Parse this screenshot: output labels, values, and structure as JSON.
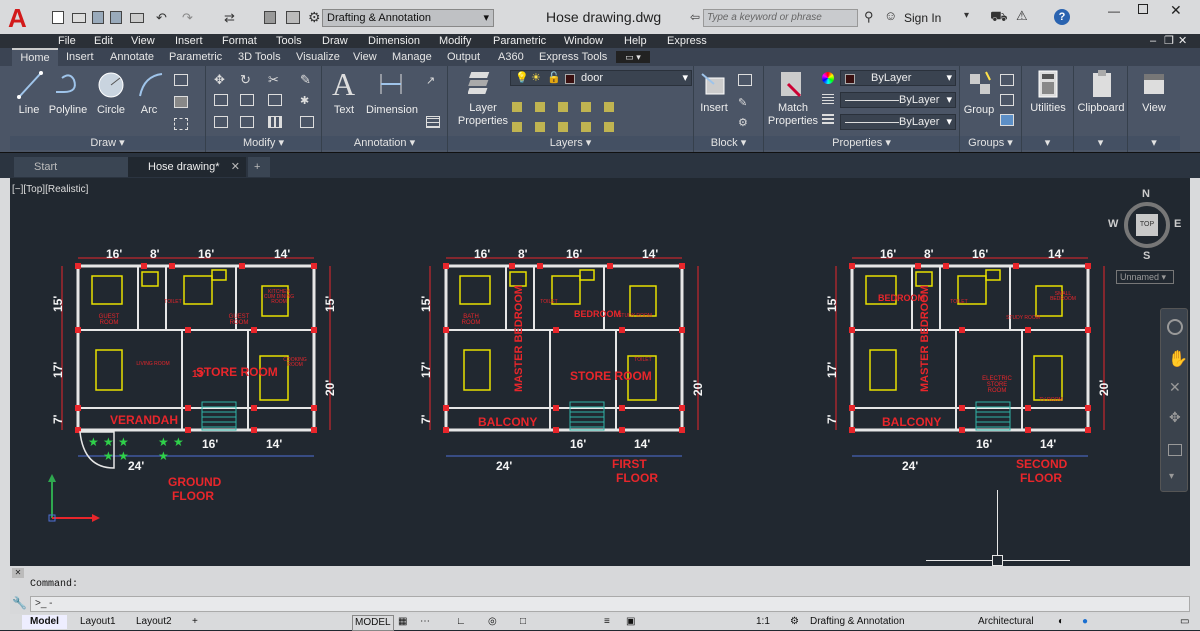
{
  "app": {
    "logo_letter": "A",
    "workspace": "Drafting & Annotation",
    "file_title": "Hose drawing.dwg",
    "search_placeholder": "Type a keyword or phrase",
    "sign_in": "Sign In",
    "help": "?"
  },
  "menu": [
    "File",
    "Edit",
    "View",
    "Insert",
    "Format",
    "Tools",
    "Draw",
    "Dimension",
    "Modify",
    "Parametric",
    "Window",
    "Help",
    "Express"
  ],
  "ribbon_tabs": [
    "Home",
    "Insert",
    "Annotate",
    "Parametric",
    "3D Tools",
    "Visualize",
    "View",
    "Manage",
    "Output",
    "A360",
    "Express Tools"
  ],
  "ribbon": {
    "draw": {
      "label": "Draw",
      "line": "Line",
      "polyline": "Polyline",
      "circle": "Circle",
      "arc": "Arc"
    },
    "modify": {
      "label": "Modify"
    },
    "annotation": {
      "label": "Annotation",
      "text": "Text",
      "dimension": "Dimension"
    },
    "layers": {
      "label": "Layers",
      "layer_properties_1": "Layer",
      "layer_properties_2": "Properties",
      "current_layer": "door"
    },
    "block": {
      "label": "Block",
      "insert": "Insert"
    },
    "properties": {
      "label": "Properties",
      "match_1": "Match",
      "match_2": "Properties",
      "color": "ByLayer",
      "linetype": "ByLayer",
      "lineweight": "ByLayer"
    },
    "groups": {
      "label": "Groups",
      "group": "Group"
    },
    "utilities": "Utilities",
    "clipboard": "Clipboard",
    "view": "View"
  },
  "doc_tabs": {
    "start": "Start",
    "active": "Hose drawing*",
    "add": "+"
  },
  "viewport": {
    "label": "[−][Top][Realistic]",
    "viewcube": {
      "n": "N",
      "s": "S",
      "e": "E",
      "w": "W",
      "top": "TOP"
    },
    "ucs_name": "Unnamed"
  },
  "drawing": {
    "ground": {
      "dims_top": [
        "16'",
        "8'",
        "16'",
        "14'"
      ],
      "dims_left": [
        "15'",
        "17'",
        "7'"
      ],
      "dims_right": [
        "15'",
        "20'"
      ],
      "dims_bottom": [
        "24'",
        "16'",
        "14'"
      ],
      "rooms": [
        "GUEST ROOM",
        "TOILET",
        "GUEST ROOM",
        "KITCHEN CUM DINING ROOM",
        "LIVING ROOM",
        "STORE ROOM",
        "COOKING ROOM",
        "VERANDAH",
        "13'"
      ],
      "title_1": "GROUND",
      "title_2": "FLOOR"
    },
    "first": {
      "dims_top": [
        "16'",
        "8'",
        "16'",
        "14'"
      ],
      "dims_left": [
        "15'",
        "17'",
        "7'"
      ],
      "dims_right": [
        "20'"
      ],
      "dims_bottom": [
        "24'",
        "16'",
        "14'"
      ],
      "rooms": [
        "BATH ROOM",
        "TOILET",
        "BEDROOM",
        "STUDY ROOM",
        "MASTER BEDROOM",
        "STORE ROOM",
        "TOILET",
        "BALCONY"
      ],
      "title_1": "FIRST",
      "title_2": "FLOOR"
    },
    "second": {
      "dims_top": [
        "16'",
        "8'",
        "16'",
        "14'"
      ],
      "dims_left": [
        "15'",
        "17'",
        "7'"
      ],
      "dims_right": [
        "20'"
      ],
      "dims_bottom": [
        "24'",
        "16'",
        "14'"
      ],
      "rooms": [
        "BEDROOM",
        "TOILET",
        "STUDY ROOM",
        "SMALL BEDROOM",
        "MASTER BEDROOM",
        "ELECTRIC STORE ROOM",
        "TV ROOM",
        "BALCONY"
      ],
      "title_1": "SECOND",
      "title_2": "FLOOR"
    }
  },
  "command": {
    "label": "Command:",
    "prompt": ">_ -"
  },
  "layout_tabs": [
    "Model",
    "Layout1",
    "Layout2",
    "+"
  ],
  "status": {
    "model": "MODEL",
    "scale": "1:1",
    "workspace": "Drafting & Annotation",
    "units": "Architectural"
  },
  "colors": {
    "accent_red": "#e8262b",
    "dim_red": "#e8262b",
    "wall_white": "#e6e6e6",
    "furniture_yellow": "#e8e000",
    "canvas_bg": "#212830"
  }
}
